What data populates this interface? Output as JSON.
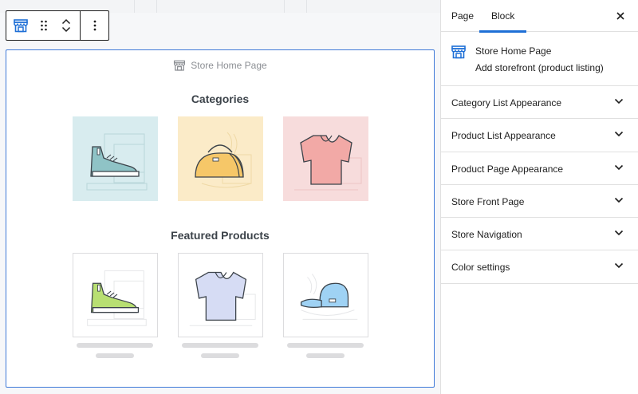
{
  "block": {
    "label": "Store Home Page",
    "categories_title": "Categories",
    "featured_title": "Featured Products"
  },
  "sidebar": {
    "tabs": [
      {
        "label": "Page",
        "active": false
      },
      {
        "label": "Block",
        "active": true
      }
    ],
    "block_card": {
      "title": "Store Home Page",
      "description": "Add storefront (product listing)"
    },
    "panels": [
      {
        "label": "Category List Appearance"
      },
      {
        "label": "Product List Appearance"
      },
      {
        "label": "Product Page Appearance"
      },
      {
        "label": "Store Front Page"
      },
      {
        "label": "Store Navigation"
      },
      {
        "label": "Color settings"
      }
    ]
  },
  "icons": {
    "toolbar": [
      "store-icon",
      "drag-handle-icon",
      "chevron-up-icon",
      "chevron-down-icon",
      "more-vertical-icon"
    ],
    "categories": [
      "sneaker-icon",
      "handbag-icon",
      "tshirt-icon"
    ],
    "products": [
      "sneaker-icon",
      "tshirt-icon",
      "cap-icon"
    ]
  },
  "colors": {
    "accent": "#1e6fd6",
    "block_border": "#3f7ad8",
    "category_tiles": [
      "#d8ecef",
      "#fbebc8",
      "#f7dcdc"
    ]
  }
}
